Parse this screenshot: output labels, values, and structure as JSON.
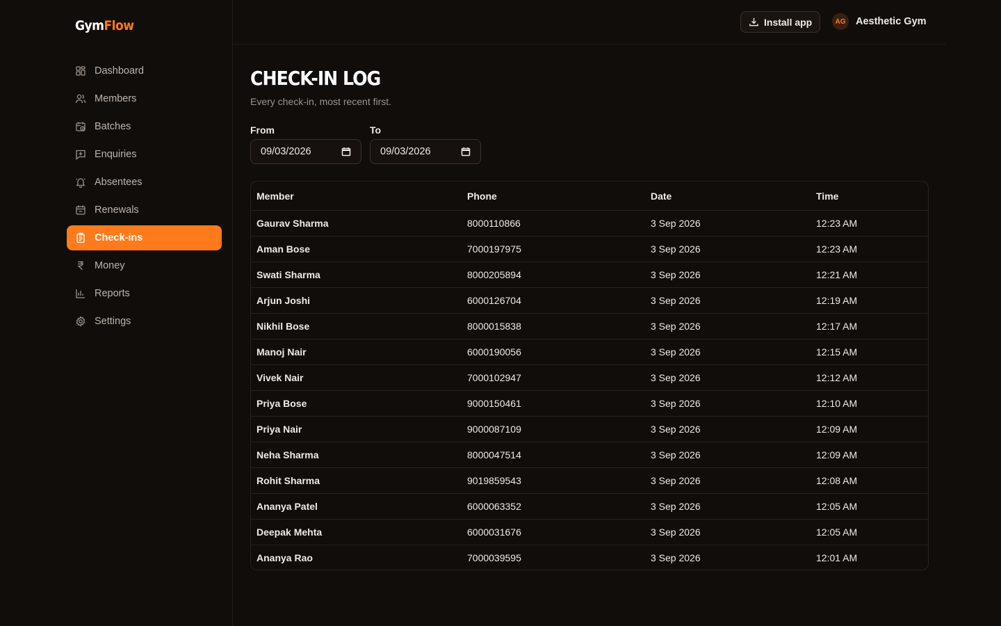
{
  "app": {
    "logo_part1": "Gym",
    "logo_part2": "Flow"
  },
  "sidebar": {
    "items": [
      {
        "label": "Dashboard",
        "icon": "dashboard-icon",
        "active": false
      },
      {
        "label": "Members",
        "icon": "users-icon",
        "active": false
      },
      {
        "label": "Batches",
        "icon": "calendar-clock-icon",
        "active": false
      },
      {
        "label": "Enquiries",
        "icon": "message-plus-icon",
        "active": false
      },
      {
        "label": "Absentees",
        "icon": "bell-off-icon",
        "active": false
      },
      {
        "label": "Renewals",
        "icon": "calendar-check-icon",
        "active": false
      },
      {
        "label": "Check-ins",
        "icon": "clipboard-icon",
        "active": true
      },
      {
        "label": "Money",
        "icon": "rupee-icon",
        "active": false
      },
      {
        "label": "Reports",
        "icon": "bar-chart-icon",
        "active": false
      },
      {
        "label": "Settings",
        "icon": "gear-icon",
        "active": false
      }
    ]
  },
  "topbar": {
    "install_label": "Install app",
    "avatar_initials": "AG",
    "account_name": "Aesthetic Gym"
  },
  "page": {
    "title": "Check-in Log",
    "subtitle": "Every check-in, most recent first."
  },
  "filters": {
    "from_label": "From",
    "from_value": "09/03/2026",
    "to_label": "To",
    "to_value": "09/03/2026"
  },
  "table": {
    "headers": [
      "Member",
      "Phone",
      "Date",
      "Time"
    ],
    "rows": [
      [
        "Gaurav Sharma",
        "8000110866",
        "3 Sep 2026",
        "12:23 AM"
      ],
      [
        "Aman Bose",
        "7000197975",
        "3 Sep 2026",
        "12:23 AM"
      ],
      [
        "Swati Sharma",
        "8000205894",
        "3 Sep 2026",
        "12:21 AM"
      ],
      [
        "Arjun Joshi",
        "6000126704",
        "3 Sep 2026",
        "12:19 AM"
      ],
      [
        "Nikhil Bose",
        "8000015838",
        "3 Sep 2026",
        "12:17 AM"
      ],
      [
        "Manoj Nair",
        "6000190056",
        "3 Sep 2026",
        "12:15 AM"
      ],
      [
        "Vivek Nair",
        "7000102947",
        "3 Sep 2026",
        "12:12 AM"
      ],
      [
        "Priya Bose",
        "9000150461",
        "3 Sep 2026",
        "12:10 AM"
      ],
      [
        "Priya Nair",
        "9000087109",
        "3 Sep 2026",
        "12:09 AM"
      ],
      [
        "Neha Sharma",
        "8000047514",
        "3 Sep 2026",
        "12:09 AM"
      ],
      [
        "Rohit Sharma",
        "9019859543",
        "3 Sep 2026",
        "12:08 AM"
      ],
      [
        "Ananya Patel",
        "6000063352",
        "3 Sep 2026",
        "12:05 AM"
      ],
      [
        "Deepak Mehta",
        "6000031676",
        "3 Sep 2026",
        "12:05 AM"
      ],
      [
        "Ananya Rao",
        "7000039595",
        "3 Sep 2026",
        "12:01 AM"
      ]
    ]
  },
  "colors": {
    "accent": "#ff7a1a",
    "background": "#110d0b"
  }
}
